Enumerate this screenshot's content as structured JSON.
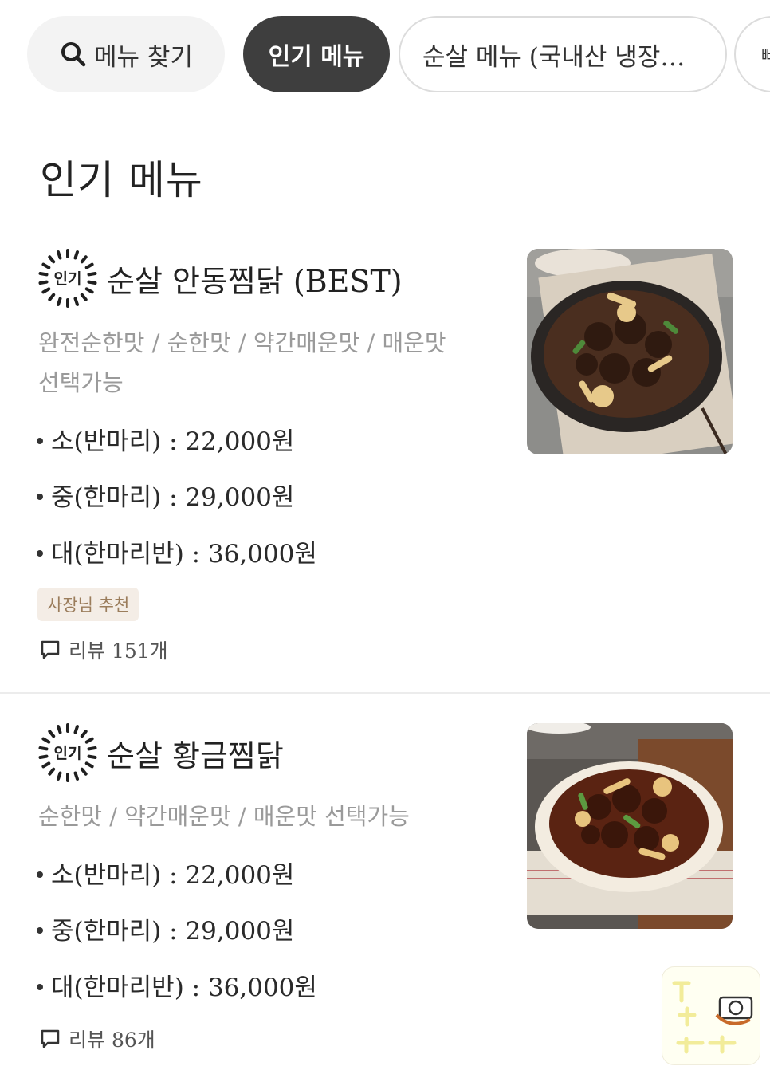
{
  "chips": {
    "search_label": "메뉴 찾기",
    "popular_label": "인기 메뉴",
    "boneless_label": "순살 메뉴 (국내산 냉장육…",
    "cut_label": "뼈"
  },
  "section": {
    "title": "인기 메뉴"
  },
  "items": [
    {
      "badge": "인기",
      "name": "순살 안동찜닭 (BEST)",
      "desc_line1": "완전순한맛 / 순한맛 / 약간매운맛 / 매운맛",
      "desc_line2": "선택가능",
      "prices": [
        "소(반마리) : 22,000원",
        "중(한마리) : 29,000원",
        "대(한마리반) : 36,000원"
      ],
      "recommend": "사장님 추천",
      "review": "리뷰 151개"
    },
    {
      "badge": "인기",
      "name": "순살 황금찜닭",
      "desc_line1": "순한맛 / 약간매운맛 / 매운맛 선택가능",
      "prices": [
        "소(반마리) : 22,000원",
        "중(한마리) : 29,000원",
        "대(한마리반) : 36,000원"
      ],
      "review": "리뷰 86개"
    }
  ],
  "colors": {
    "chip_active_bg": "#3e3e3e",
    "chip_bg": "#f3f3f3",
    "desc_gray": "#9a9a9a",
    "recommend_bg": "#f4ede6",
    "recommend_text": "#9b7d5c"
  }
}
